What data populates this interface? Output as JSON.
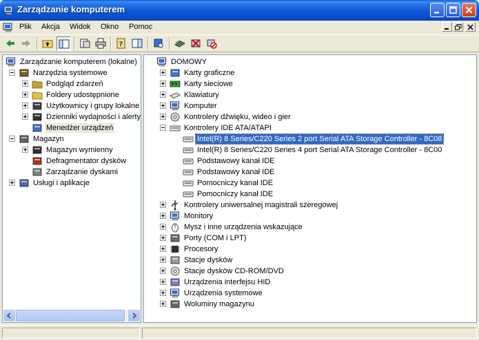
{
  "window": {
    "title": "Zarządzanie komputerem"
  },
  "menu": [
    "Plik",
    "Akcja",
    "Widok",
    "Okno",
    "Pomoc"
  ],
  "left_tree": [
    {
      "label": "Zarządzanie komputerem (lokalne)",
      "icon": "computer-management-icon"
    },
    {
      "label": "Narzędzia systemowe",
      "icon": "system-tools-icon"
    },
    {
      "label": "Podgląd zdarzeń",
      "icon": "event-viewer-icon"
    },
    {
      "label": "Foldery udostępnione",
      "icon": "shared-folders-icon"
    },
    {
      "label": "Użytkownicy i grupy lokalne",
      "icon": "users-groups-icon"
    },
    {
      "label": "Dzienniki wydajności i alerty",
      "icon": "performance-logs-icon"
    },
    {
      "label": "Menedżer urządzeń",
      "icon": "device-manager-icon"
    },
    {
      "label": "Magazyn",
      "icon": "storage-icon"
    },
    {
      "label": "Magazyn wymienny",
      "icon": "removable-storage-icon"
    },
    {
      "label": "Defragmentator dysków",
      "icon": "defragmenter-icon"
    },
    {
      "label": "Zarządzanie dyskami",
      "icon": "disk-management-icon"
    },
    {
      "label": "Usługi i aplikacje",
      "icon": "services-applications-icon"
    }
  ],
  "right_tree": [
    {
      "label": "DOMOWY",
      "icon": "computer-icon"
    },
    {
      "label": "Karty graficzne",
      "icon": "display-adapter-icon"
    },
    {
      "label": "Karty sieciowe",
      "icon": "network-adapter-icon"
    },
    {
      "label": "Klawiatury",
      "icon": "keyboard-icon"
    },
    {
      "label": "Komputer",
      "icon": "computer-icon"
    },
    {
      "label": "Kontrolery dźwięku, wideo i gier",
      "icon": "sound-icon"
    },
    {
      "label": "Kontrolery IDE ATA/ATAPI",
      "icon": "ide-controller-icon"
    },
    {
      "label": "Intel(R) 8 Series/C220 Series 2 port Serial ATA Storage Controller - 8C08",
      "icon": "ide-channel-icon"
    },
    {
      "label": "Intel(R) 8 Series/C220 Series 4 port Serial ATA Storage Controller - 8C00",
      "icon": "ide-channel-icon"
    },
    {
      "label": "Podstawowy kanał IDE",
      "icon": "ide-channel-icon"
    },
    {
      "label": "Podstawowy kanał IDE",
      "icon": "ide-channel-icon"
    },
    {
      "label": "Pomocniczy kanał IDE",
      "icon": "ide-channel-icon"
    },
    {
      "label": "Pomocniczy kanał IDE",
      "icon": "ide-channel-icon"
    },
    {
      "label": "Kontrolery uniwersalnej magistrali szeregowej",
      "icon": "usb-icon"
    },
    {
      "label": "Monitory",
      "icon": "monitor-icon"
    },
    {
      "label": "Mysz i inne urządzenia wskazujące",
      "icon": "mouse-icon"
    },
    {
      "label": "Porty (COM i LPT)",
      "icon": "port-icon"
    },
    {
      "label": "Procesory",
      "icon": "processor-icon"
    },
    {
      "label": "Stacje dysków",
      "icon": "disk-drive-icon"
    },
    {
      "label": "Stacje dysków CD-ROM/DVD",
      "icon": "cdrom-icon"
    },
    {
      "label": "Urządzenia interfejsu HID",
      "icon": "hid-icon"
    },
    {
      "label": "Urządzenia systemowe",
      "icon": "system-devices-icon"
    },
    {
      "label": "Woluminy magazynu",
      "icon": "storage-volume-icon"
    }
  ]
}
